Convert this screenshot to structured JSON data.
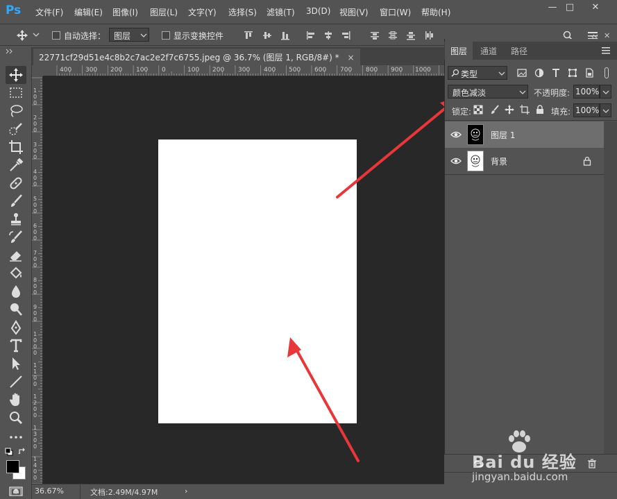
{
  "app": {
    "logo": "Ps",
    "menu": [
      "文件(F)",
      "编辑(E)",
      "图像(I)",
      "图层(L)",
      "文字(Y)",
      "选择(S)",
      "滤镜(T)",
      "3D(D)",
      "视图(V)",
      "窗口(W)",
      "帮助(H)"
    ],
    "window_buttons": [
      "—",
      "□",
      "✕"
    ]
  },
  "options": {
    "auto_select_label": "自动选择：",
    "auto_select_target": "图层",
    "show_transform_label": "显示变换控件"
  },
  "document": {
    "tab_title": "22771cf29d51e4c8b2c7ac2e2f7c6755.jpeg @ 36.7% (图层 1, RGB/8#) *",
    "close_glyph": "×",
    "ruler_top_labels": [
      "400",
      "300",
      "200",
      "100",
      "0",
      "100",
      "200",
      "300",
      "400",
      "500",
      "600",
      "700",
      "800",
      "900",
      "1000"
    ],
    "ruler_left_labels": [
      "0",
      "1 0 0",
      "2 0 0",
      "3 0 0",
      "4 0 0",
      "5 0 0",
      "6 0 0",
      "7 0 0",
      "8 0 0",
      "9 0 0",
      "1 0 0 0",
      "1 1 0 0",
      "1 2 0 0",
      "1 3 0 0",
      "1 4 0 0"
    ]
  },
  "status": {
    "zoom": "36.67%",
    "doc_info": "文档:2.49M/4.97M",
    "arrow": "›"
  },
  "panel": {
    "tabs": [
      "图层",
      "通道",
      "路径"
    ],
    "filter_kind": "类型",
    "blend_mode": "颜色减淡",
    "opacity_label": "不透明度:",
    "opacity_value": "100%",
    "lock_label": "锁定:",
    "fill_label": "填充:",
    "fill_value": "100%",
    "layers": [
      {
        "name": "图层 1",
        "selected": true,
        "locked": false
      },
      {
        "name": "背景",
        "selected": false,
        "locked": true
      }
    ]
  },
  "watermark": {
    "brand": "Bai du 经验",
    "url": "jingyan.baidu.com"
  },
  "colors": {
    "ui_bg": "#535353",
    "canvas_bg": "#282828",
    "arrow": "#e8363a",
    "ps_blue": "#31a8ff"
  }
}
